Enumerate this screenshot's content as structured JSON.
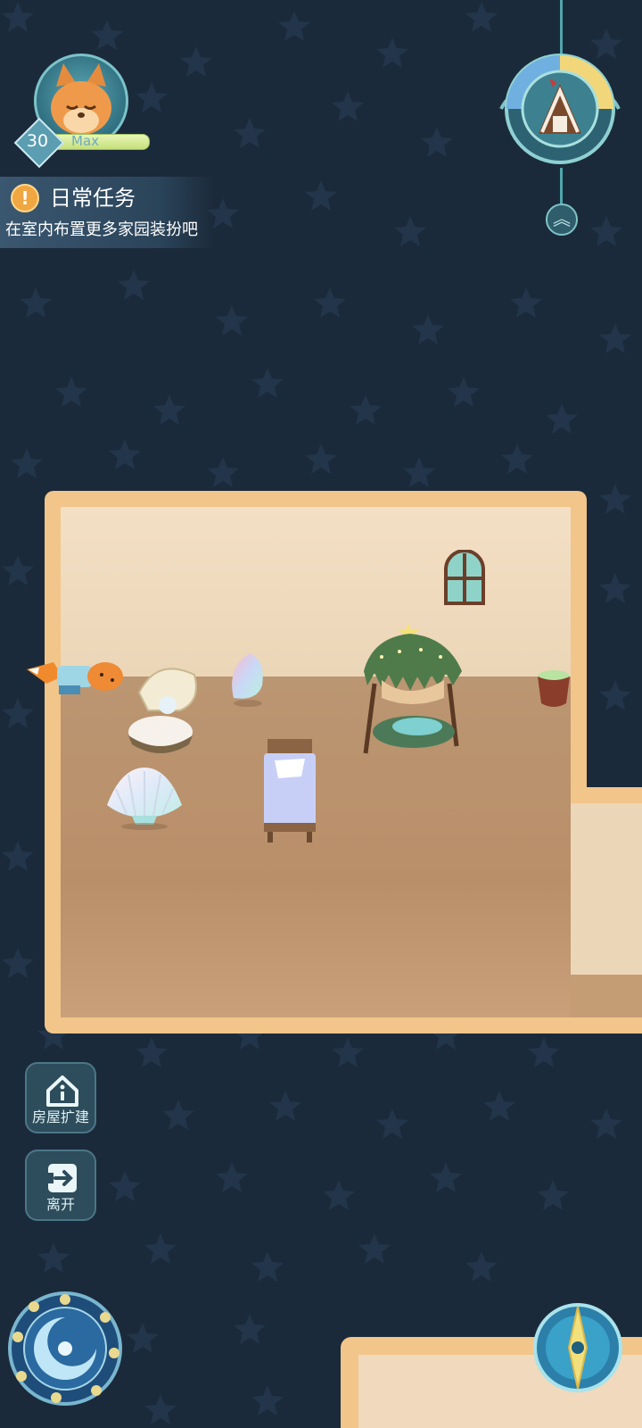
{
  "player": {
    "level": "30",
    "level_status": "Max",
    "avatar": "fox-avatar-icon"
  },
  "daily_task": {
    "icon": "exclamation-icon",
    "title": "日常任务",
    "description": "在室内布置更多家园装扮吧"
  },
  "season_clock": {
    "icon": "gingerbread-house-icon",
    "expand_icon": "chevron-double-up-icon"
  },
  "side_buttons": {
    "expand_house_label": "房屋扩建",
    "expand_house_icon": "house-info-icon",
    "leave_label": "离开",
    "leave_icon": "exit-door-icon"
  },
  "bottom_buttons": {
    "moon_icon": "moon-phase-icon",
    "compass_icon": "compass-icon"
  },
  "colors": {
    "background": "#1b2a3a",
    "room_border": "#f2c58a",
    "accent": "#4fa7ad"
  }
}
